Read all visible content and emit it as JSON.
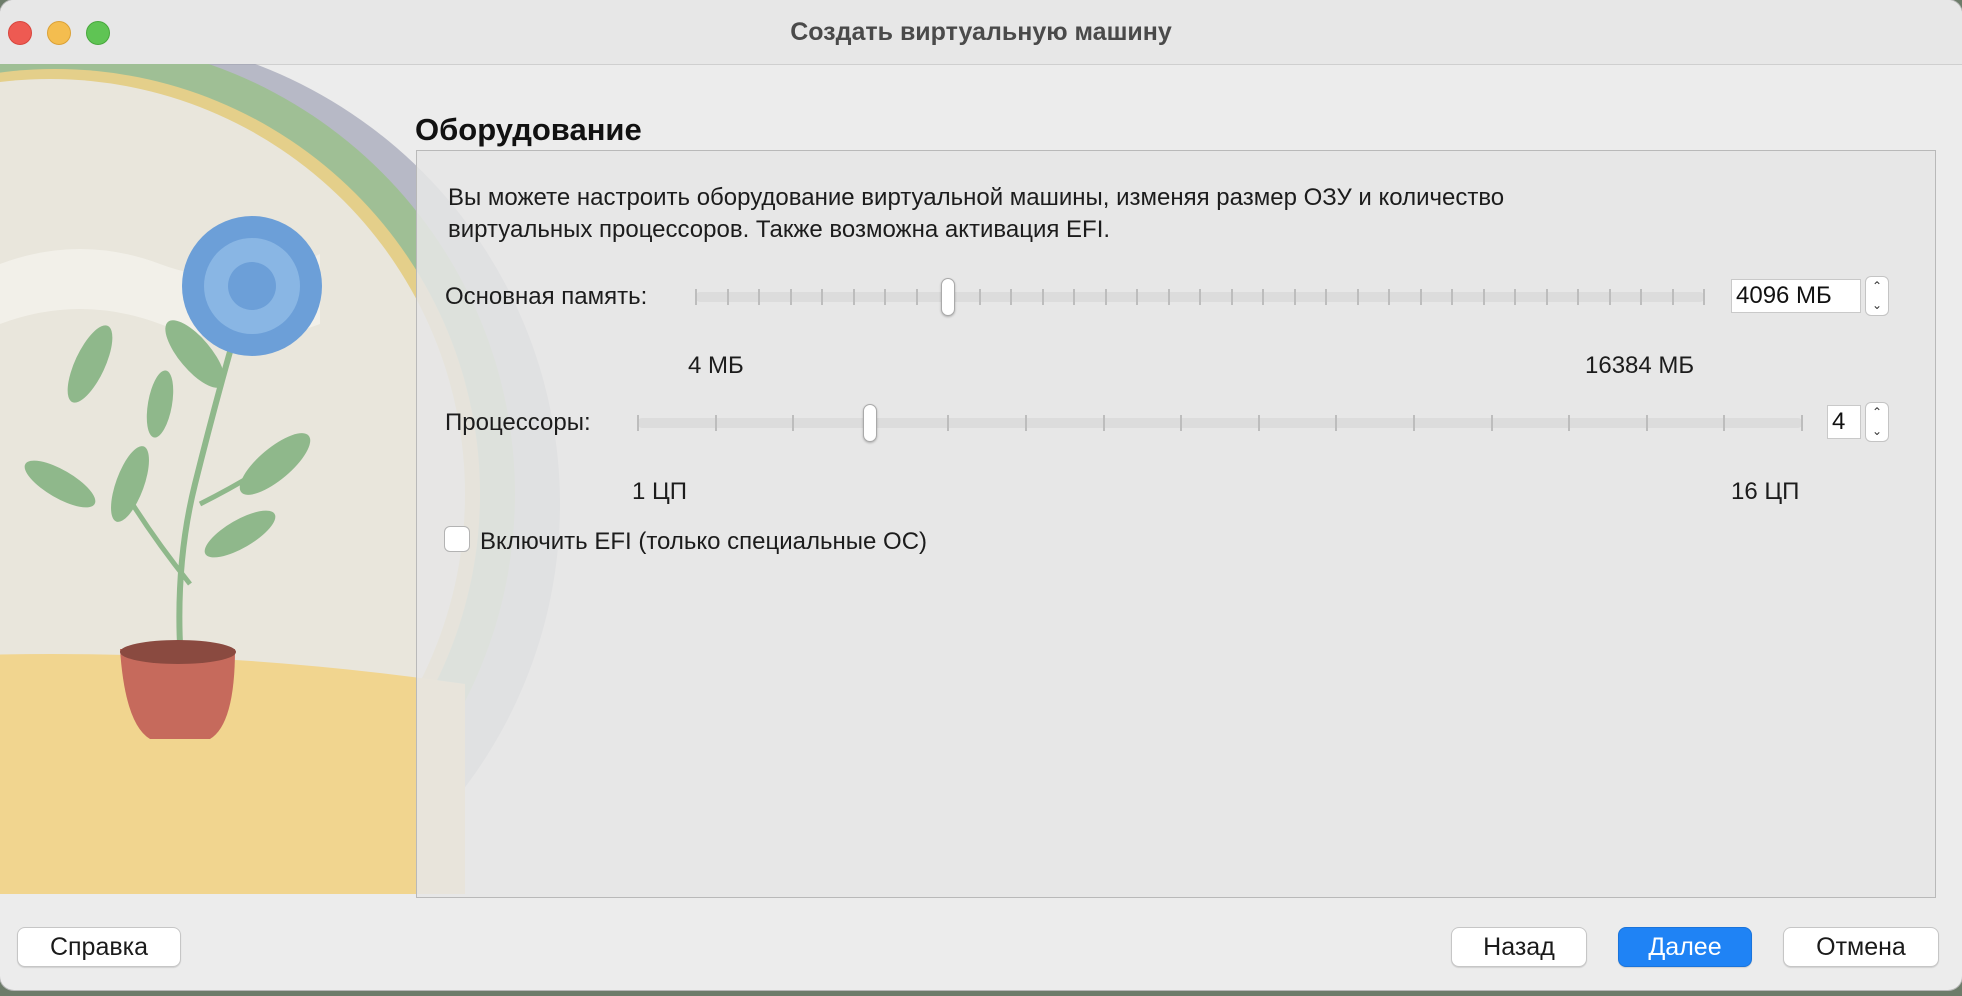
{
  "window": {
    "title": "Создать виртуальную машину"
  },
  "page": {
    "heading": "Оборудование",
    "description_line1": "Вы можете настроить оборудование виртуальной машины, изменяя размер ОЗУ и количество",
    "description_line2": "виртуальных процессоров. Также возможна активация EFI."
  },
  "memory": {
    "label": "Основная память:",
    "value": "4096 МБ",
    "min_label": "4 МБ",
    "max_label": "16384 МБ",
    "level": 0.25
  },
  "cpu": {
    "label": "Процессоры:",
    "value": "4",
    "min_label": "1 ЦП",
    "max_label": "16 ЦП",
    "level": 0.2
  },
  "efi": {
    "label": "Включить EFI (только специальные ОС)",
    "checked": false
  },
  "buttons": {
    "help": "Справка",
    "back": "Назад",
    "next": "Далее",
    "cancel": "Отмена"
  },
  "colors": {
    "accent": "#1f83f5",
    "background": "#ececec"
  },
  "icons": {
    "stepper_up": "chevron-up-icon",
    "stepper_down": "chevron-down-icon"
  }
}
